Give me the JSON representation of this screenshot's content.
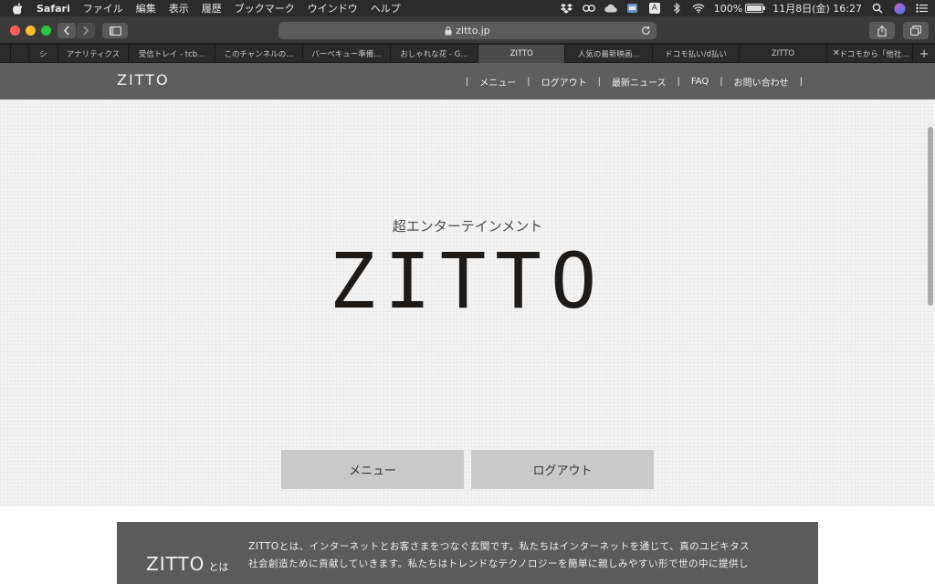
{
  "menubar": {
    "app_name": "Safari",
    "items": [
      "ファイル",
      "編集",
      "表示",
      "履歴",
      "ブックマーク",
      "ウインドウ",
      "ヘルプ"
    ],
    "input_indicator": "A",
    "battery": "100%",
    "battery_level": 1.0,
    "datetime": "11月8日(金) 16:27"
  },
  "toolbar": {
    "url": "zitto.jp"
  },
  "tabs": [
    {
      "label": "シ"
    },
    {
      "label": "アナリティクス"
    },
    {
      "label": "受信トレイ - tcb..."
    },
    {
      "label": "このチャンネルの..."
    },
    {
      "label": "バーベキュー準備..."
    },
    {
      "label": "おしゃれな花 - G..."
    },
    {
      "label": "ZITTO",
      "active": true
    },
    {
      "label": "人気の最新映画..."
    },
    {
      "label": "ドコモ払い/d払い"
    },
    {
      "label": "ZITTO"
    },
    {
      "label": "ドコモから「他社..."
    }
  ],
  "site": {
    "logo": "ZITTO",
    "nav": {
      "separator": "|",
      "items": [
        "メニュー",
        "ログアウト",
        "最新ニュース",
        "FAQ",
        "お問い合わせ"
      ]
    },
    "hero": {
      "subtitle": "超エンターテインメント",
      "title": "ZITTO"
    },
    "buttons": {
      "menu": "メニュー",
      "logout": "ログアウト"
    },
    "about": {
      "logo": "ZITTO",
      "logo_suffix": "とは",
      "line1": "ZITTOとは、インターネットとお客さまをつなぐ玄関です。私たちはインターネットを通じて、真のユビキタス",
      "line2": "社会創造ために貢献していきます。私たちはトレンドなテクノロジーを簡単に親しみやすい形で世の中に提供し"
    }
  }
}
